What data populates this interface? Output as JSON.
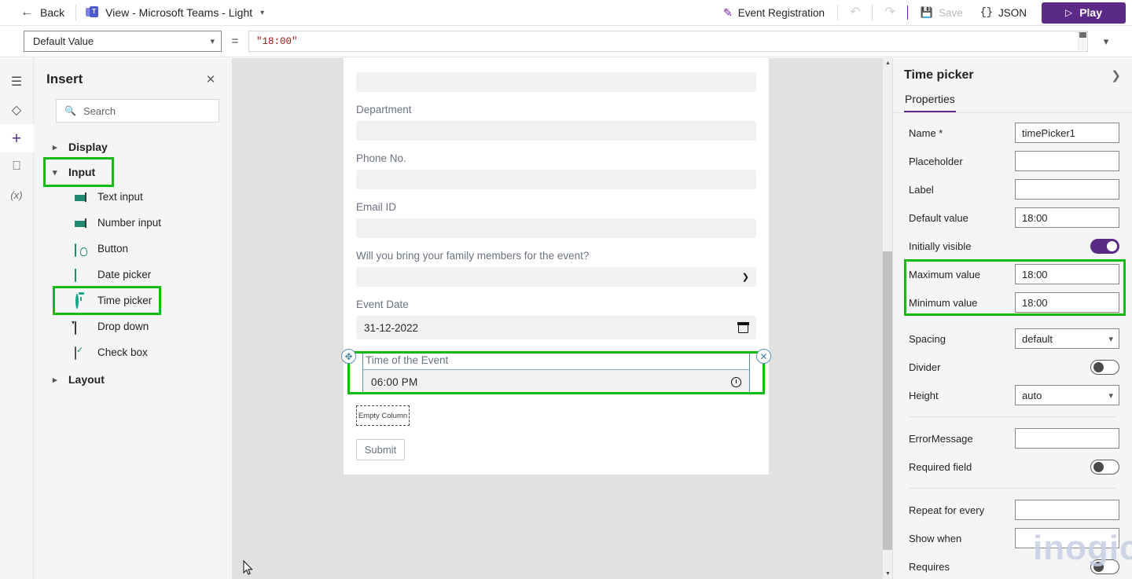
{
  "topbar": {
    "back_label": "Back",
    "back_icon": "arrow-left-icon",
    "view_label": "View - Microsoft Teams - Light",
    "view_icon": "teams-icon",
    "view_chevron": "chevron-down-icon",
    "app_name_label": "Event Registration",
    "app_name_icon": "pencil-icon",
    "undo_icon": "undo-icon",
    "redo_icon": "redo-icon",
    "save_label": "Save",
    "save_icon": "save-disk-icon",
    "json_label": "JSON",
    "json_icon": "curly-braces-icon",
    "play_label": "Play",
    "play_icon": "play-triangle-icon",
    "accent_color": "#5b2a86"
  },
  "formula_bar": {
    "property_selected": "Default Value",
    "property_chevron": "chevron-down-icon",
    "equals": "=",
    "formula_value": "\"18:00\"",
    "expand_chevron": "chevron-down-icon"
  },
  "rail": {
    "items": [
      {
        "icon": "hamburger-menu-icon",
        "active": false
      },
      {
        "icon": "layers-icon",
        "active": false
      },
      {
        "icon": "plus-icon",
        "active": true
      },
      {
        "icon": "database-icon",
        "active": false
      },
      {
        "icon": "variables-icon",
        "active": false,
        "glyph": "(x)"
      }
    ]
  },
  "insert_panel": {
    "title": "Insert",
    "close_icon": "close-icon",
    "search": {
      "placeholder": "Search",
      "value": "",
      "icon": "search-icon"
    },
    "groups": [
      {
        "label": "Display",
        "expanded": false,
        "chevron": "chevron-right-icon",
        "highlighted": false,
        "items": []
      },
      {
        "label": "Input",
        "expanded": true,
        "chevron": "chevron-down-icon",
        "highlighted": true,
        "items": [
          {
            "label": "Text input",
            "icon": "text-input-icon",
            "highlighted": false
          },
          {
            "label": "Number input",
            "icon": "number-input-icon",
            "highlighted": false
          },
          {
            "label": "Button",
            "icon": "button-icon",
            "highlighted": false
          },
          {
            "label": "Date picker",
            "icon": "calendar-icon",
            "highlighted": false
          },
          {
            "label": "Time picker",
            "icon": "clock-icon",
            "highlighted": true
          },
          {
            "label": "Drop down",
            "icon": "dropdown-icon",
            "highlighted": false
          },
          {
            "label": "Check box",
            "icon": "checkbox-icon",
            "highlighted": false
          }
        ]
      },
      {
        "label": "Layout",
        "expanded": false,
        "chevron": "chevron-right-icon",
        "highlighted": false,
        "items": []
      }
    ],
    "highlight_color": "#11bb11"
  },
  "canvas": {
    "fields": [
      {
        "type": "input",
        "label": "",
        "value": ""
      },
      {
        "type": "input",
        "label": "Department",
        "value": ""
      },
      {
        "type": "input",
        "label": "Phone No.",
        "value": ""
      },
      {
        "type": "input",
        "label": "Email ID",
        "value": ""
      },
      {
        "type": "select",
        "label": "Will you bring your family members for the event?",
        "value": "",
        "chevron": "chevron-down-icon"
      },
      {
        "type": "date",
        "label": "Event Date",
        "value": "31-12-2022",
        "icon": "calendar-icon"
      }
    ],
    "selected_control": {
      "label": "Time of the Event",
      "value": "06:00 PM",
      "icon": "clock-icon",
      "move_handle_icon": "move-handle-icon",
      "delete_handle_icon": "delete-circle-icon",
      "highlight_color": "#11bb11"
    },
    "empty_column_label": "Empty Column",
    "submit_label": "Submit",
    "scrollbar": {
      "up_icon": "caret-up-icon",
      "down_icon": "caret-down-icon"
    }
  },
  "properties": {
    "title": "Time picker",
    "expand_icon": "chevron-right-icon",
    "tab_label": "Properties",
    "rows": [
      {
        "key": "Name *",
        "type": "input",
        "value": "timePicker1"
      },
      {
        "key": "Placeholder",
        "type": "input",
        "value": ""
      },
      {
        "key": "Label",
        "type": "input",
        "value": ""
      },
      {
        "key": "Default value",
        "type": "input",
        "value": "18:00"
      },
      {
        "key": "Initially visible",
        "type": "toggle",
        "value": "on"
      },
      {
        "key": "Maximum value",
        "type": "input",
        "value": "18:00",
        "highlighted": true
      },
      {
        "key": "Minimum value",
        "type": "input",
        "value": "18:00",
        "highlighted": true
      },
      {
        "key": "Spacing",
        "type": "select",
        "value": "default"
      },
      {
        "key": "Divider",
        "type": "toggle",
        "value": "off"
      },
      {
        "key": "Height",
        "type": "select",
        "value": "auto"
      },
      {
        "key": "ErrorMessage",
        "type": "input",
        "value": ""
      },
      {
        "key": "Required field",
        "type": "toggle",
        "value": "off"
      },
      {
        "key": "Repeat for every",
        "type": "input",
        "value": ""
      },
      {
        "key": "Show when",
        "type": "input",
        "value": ""
      },
      {
        "key": "Requires",
        "type": "toggle",
        "value": "off"
      }
    ],
    "highlight_color": "#11bb11"
  },
  "watermark": {
    "text": "inogic"
  }
}
